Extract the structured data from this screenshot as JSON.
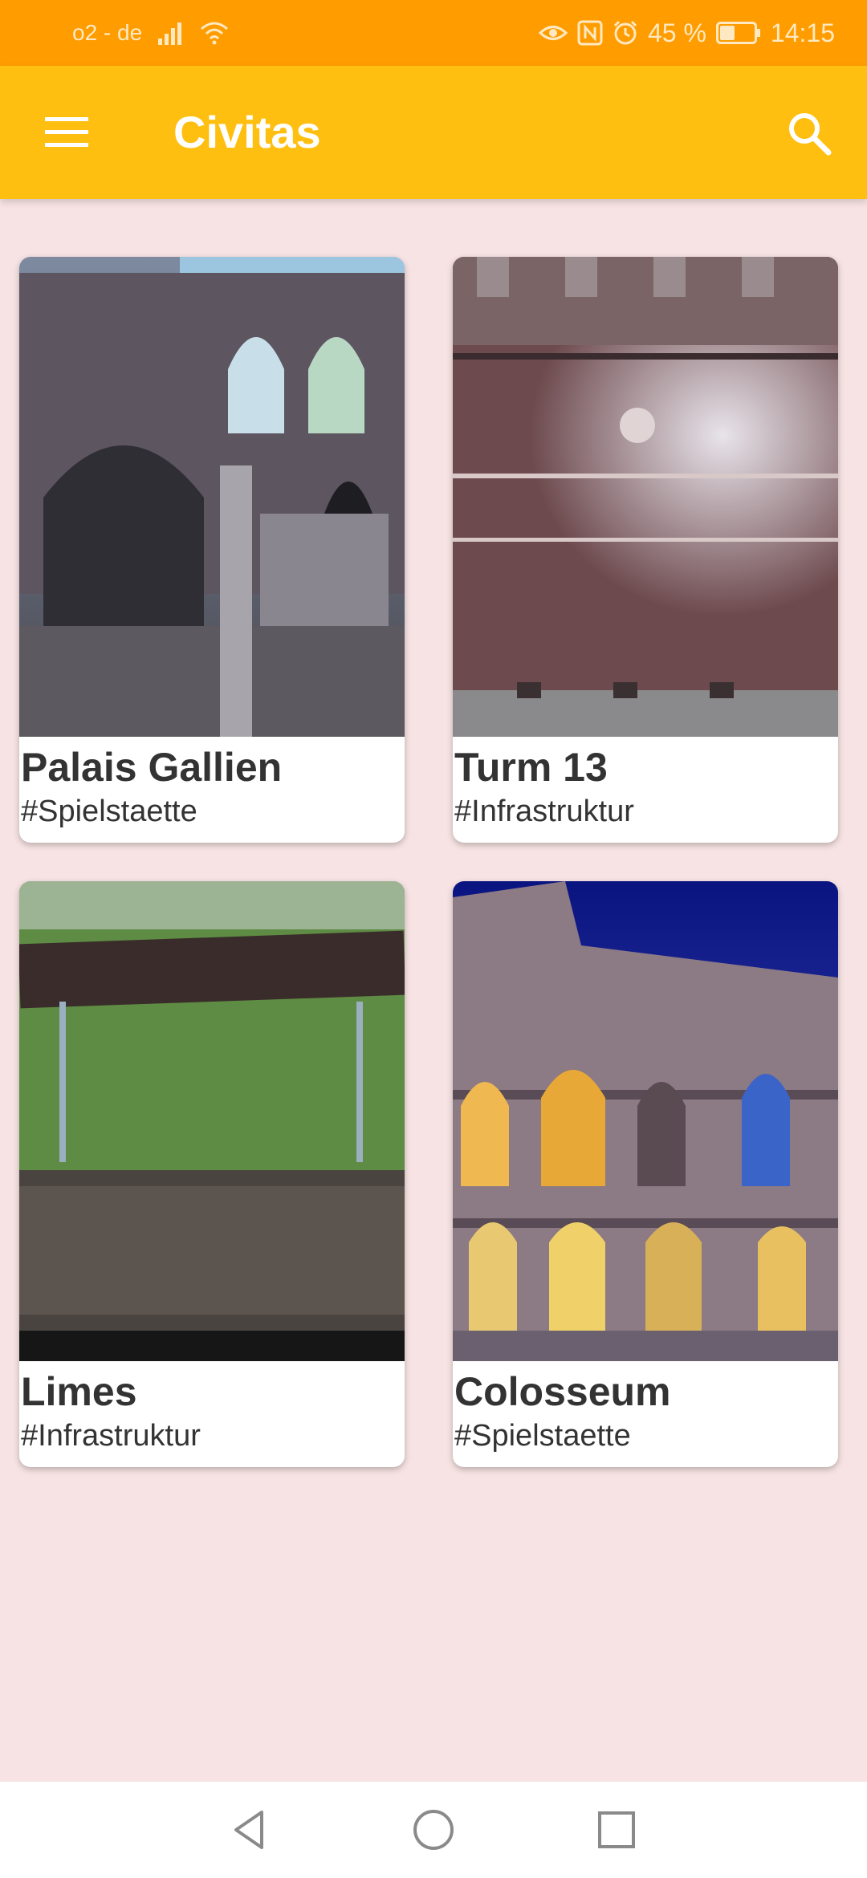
{
  "status_bar": {
    "carrier": "o2 - de",
    "battery_percent_label": "45 %",
    "time": "14:15",
    "icons": [
      "signal-icon",
      "wifi-icon",
      "eye-icon",
      "nfc-icon",
      "alarm-icon",
      "battery-icon"
    ],
    "battery_level": 0.45
  },
  "app_bar": {
    "title": "Civitas",
    "menu_icon": "hamburger-menu-icon",
    "search_icon": "search-icon"
  },
  "cards": [
    {
      "title": "Palais Gallien",
      "tag": "#Spielstaette",
      "image": "roman-ruin-arches-photo"
    },
    {
      "title": "Turm 13",
      "tag": "#Infrastruktur",
      "image": "round-brick-tower-photo"
    },
    {
      "title": "Limes",
      "tag": "#Infrastruktur",
      "image": "limes-sign-meadow-photo"
    },
    {
      "title": "Colosseum",
      "tag": "#Spielstaette",
      "image": "colosseum-night-photo"
    }
  ],
  "nav_bar": {
    "icons": [
      "back-triangle-icon",
      "home-circle-icon",
      "recents-square-icon"
    ]
  },
  "colors": {
    "status_bar": "#ff9c00",
    "app_bar": "#ffbf10",
    "background": "#f7e3e3",
    "card": "#ffffff",
    "text": "#333333"
  }
}
